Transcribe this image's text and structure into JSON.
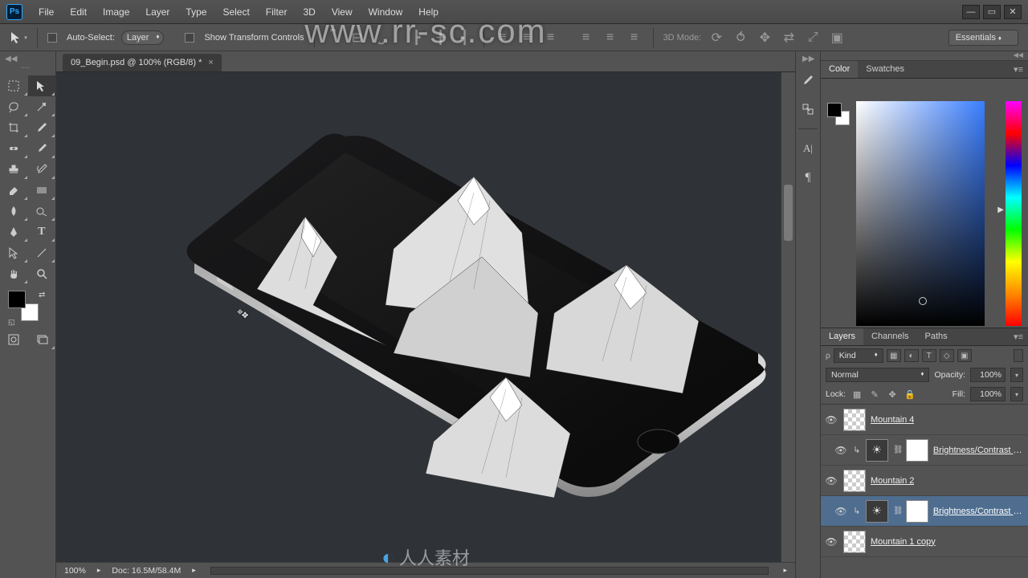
{
  "app": {
    "logo": "Ps"
  },
  "menubar": [
    "File",
    "Edit",
    "Image",
    "Layer",
    "Type",
    "Select",
    "Filter",
    "3D",
    "View",
    "Window",
    "Help"
  ],
  "window_controls": {
    "min": "—",
    "max": "▭",
    "close": "✕"
  },
  "optionsbar": {
    "auto_select_label": "Auto-Select:",
    "auto_select_target": "Layer",
    "show_transform_label": "Show Transform Controls",
    "mode3d_label": "3D Mode:",
    "workspace": "Essentials"
  },
  "document": {
    "tab_title": "09_Begin.psd @ 100% (RGB/8) *",
    "close_glyph": "×"
  },
  "statusbar": {
    "zoom": "100%",
    "doc_label": "Doc:",
    "doc_value": "16.5M/58.4M"
  },
  "right_strip_icons": [
    "brush-icon",
    "clone-source-icon",
    "divider",
    "char-icon",
    "para-icon"
  ],
  "color_panel": {
    "tab1": "Color",
    "tab2": "Swatches"
  },
  "layers_panel": {
    "tab1": "Layers",
    "tab2": "Channels",
    "tab3": "Paths",
    "kind_label": "Kind",
    "blend_mode": "Normal",
    "opacity_label": "Opacity:",
    "opacity_value": "100%",
    "lock_label": "Lock:",
    "fill_label": "Fill:",
    "fill_value": "100%",
    "layers": [
      {
        "name": "Mountain 4",
        "type": "bitmap",
        "visible": true,
        "clipped": false
      },
      {
        "name": "Brightness/Contrast 1...",
        "type": "adjustment",
        "visible": true,
        "clipped": true
      },
      {
        "name": "Mountain 2",
        "type": "bitmap",
        "visible": true,
        "clipped": false
      },
      {
        "name": "Brightness/Contrast 1...",
        "type": "adjustment",
        "visible": true,
        "clipped": true,
        "selected": true
      },
      {
        "name": "Mountain 1 copy",
        "type": "bitmap",
        "visible": true,
        "clipped": false
      }
    ]
  },
  "watermark": {
    "url": "www.rr-sc.com",
    "sub": "人人素材"
  },
  "tools_left": [
    [
      "marquee",
      "move"
    ],
    [
      "lasso",
      "wand"
    ],
    [
      "crop",
      "eyedropper"
    ],
    [
      "heal",
      "brush"
    ],
    [
      "stamp",
      "history"
    ],
    [
      "eraser",
      "gradient"
    ],
    [
      "blur",
      "dodge"
    ],
    [
      "pen",
      "type"
    ],
    [
      "path-sel",
      "line"
    ],
    [
      "hand",
      "zoom"
    ]
  ]
}
